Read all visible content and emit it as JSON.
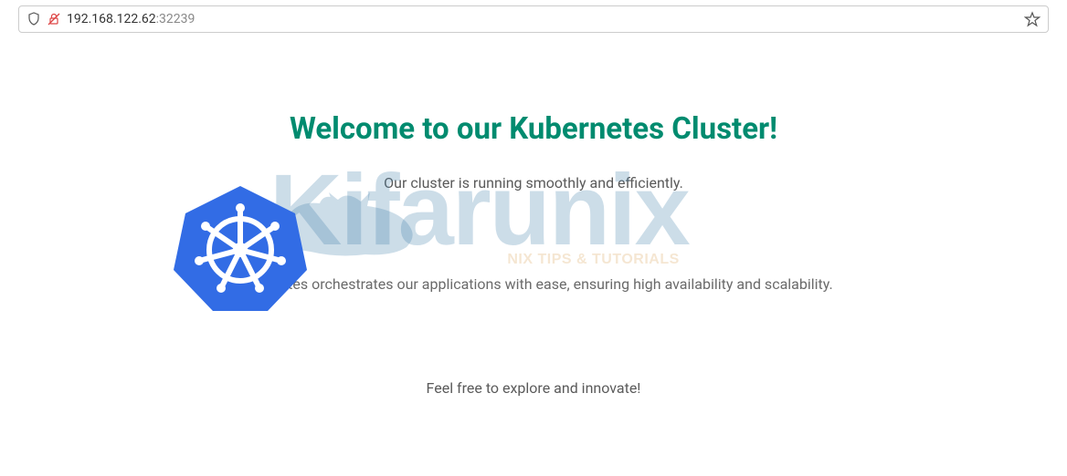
{
  "url": {
    "host": "192.168.122.62",
    "port": ":32239"
  },
  "page": {
    "title": "Welcome to our Kubernetes Cluster!",
    "subtitle": "Our cluster is running smoothly and efficiently.",
    "body": "Kubernetes orchestrates our applications with ease, ensuring high availability and scalability.",
    "footer": "Feel free to explore and innovate!"
  },
  "watermark": {
    "brand_first": "K",
    "brand_rest": "ifarunix",
    "tagline": "NIX TIPS & TUTORIALS"
  },
  "icons": {
    "shield": "shield-icon",
    "insecure": "insecure-lock-icon",
    "bookmark": "star-icon",
    "k8s": "kubernetes-logo"
  }
}
